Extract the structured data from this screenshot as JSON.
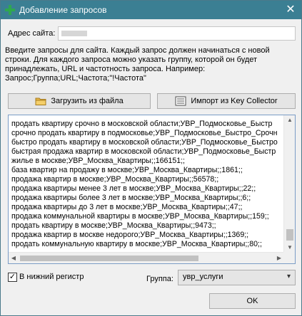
{
  "window": {
    "title": "Добавление запросов",
    "close_glyph": "✕"
  },
  "form": {
    "site_label": "Адрес сайта:",
    "description": "Введите запросы для сайта. Каждый запрос должен начинаться с новой строки. Для каждого запроса можно указать группу, которой он будет принадлежать, URL и частотность запроса. Например: Запрос;Группа;URL;Частота;\"!Частота\"",
    "load_button": "Загрузить из файла",
    "import_button": "Импорт из Key Collector",
    "lines": [
      "продать квартиру срочно в московской области;УВР_Подмосковье_Быстр",
      "срочно продать квартиру в подмосковье;УВР_Подмосковье_Быстро_Срочн",
      "быстро продать квартиру в московской области;УВР_Подмосковье_Быстро",
      "быстрая продажа квартир в московской области;УВР_Подмосковье_Быстр",
      "жилье в москве;УВР_Москва_Квартиры;;166151;;",
      "база квартир на продажу в москве;УВР_Москва_Квартиры;;1861;;",
      "продажа квартир в москве;УВР_Москва_Квартиры;;56578;;",
      "продажа квартиры менее 3 лет в москве;УВР_Москва_Квартиры;;22;;",
      "продажа квартиры более 3 лет в москве;УВР_Москва_Квартиры;;6;;",
      "продажа квартиры до 3 лет в москве;УВР_Москва_Квартиры;;47;;",
      "продажа коммунальной квартиры в москве;УВР_Москва_Квартиры;;159;;",
      "продать квартиру в москве;УВР_Москва_Квартиры;;9473;;",
      "продажа квартир в москве недорого;УВР_Москва_Квартиры;;1369;;",
      "продать коммунальную квартиру в москве;УВР_Москва_Квартиры;;80;;"
    ],
    "lowercase_label": "В нижний регистр",
    "lowercase_checked": "✓",
    "group_label": "Группа:",
    "group_value": "увр_услуги",
    "ok_button": "OK"
  },
  "colors": {
    "titlebar": "#3b7f93",
    "plus_icon": "#2fa84f",
    "folder_icon": "#e8b84a"
  },
  "icons": {
    "title": "plus-icon",
    "load": "folder-icon",
    "import": "import-icon",
    "select": "chevron-down-icon"
  }
}
